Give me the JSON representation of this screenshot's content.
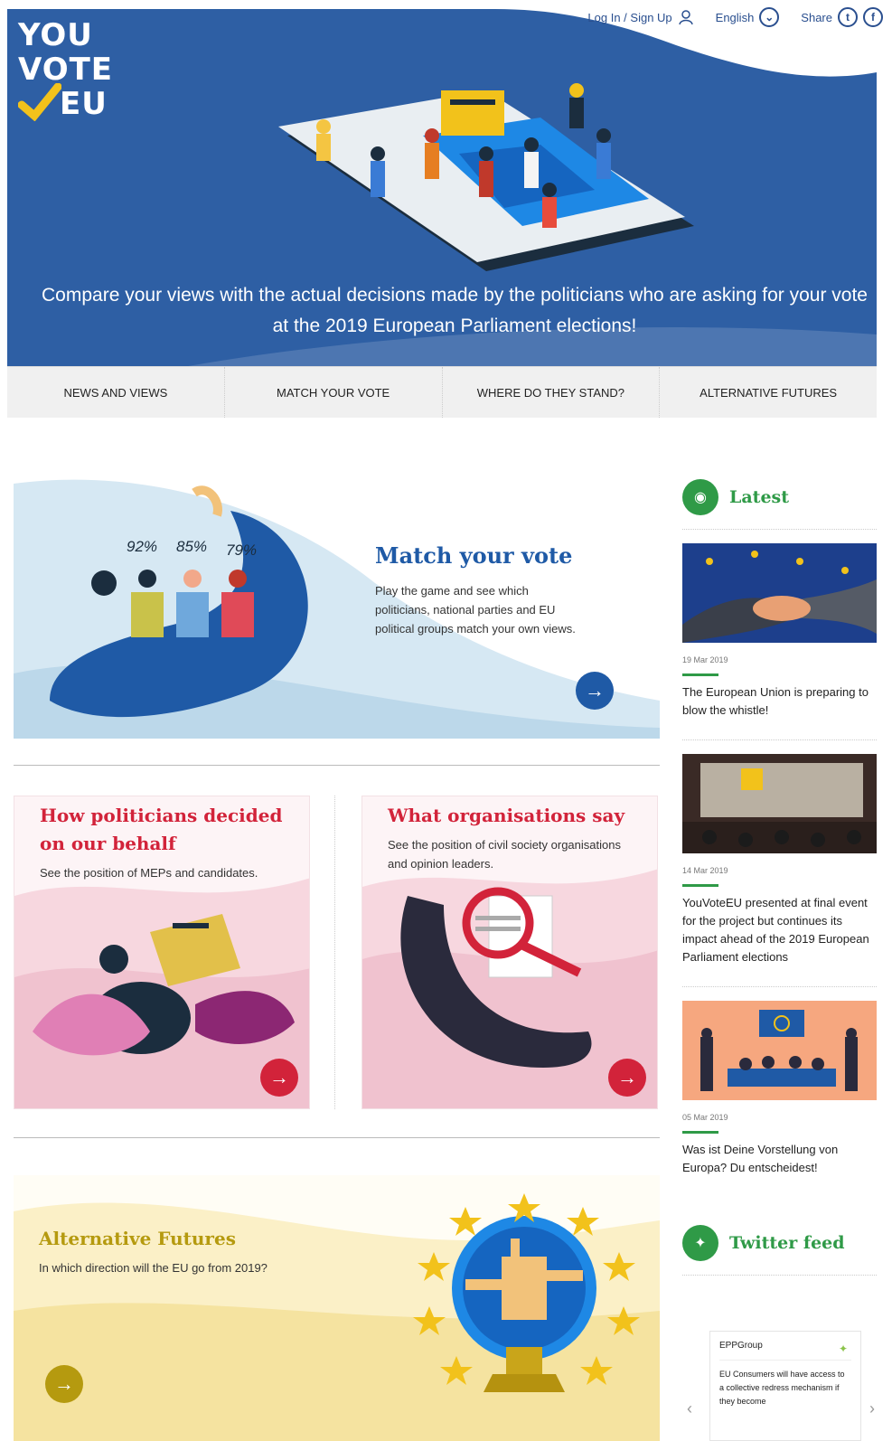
{
  "brand": {
    "line1": "YOU",
    "line2": "VOTE",
    "line3": "EU"
  },
  "topbar": {
    "login_label": "Log In / Sign Up",
    "language_label": "English",
    "share_label": "Share"
  },
  "hero": {
    "tagline": "Compare your views with the actual decisions made by the politicians who are asking for your vote at the 2019 European Parliament elections!"
  },
  "nav": {
    "items": [
      {
        "label": "NEWS AND VIEWS"
      },
      {
        "label": "MATCH YOUR VOTE"
      },
      {
        "label": "WHERE DO THEY STAND?"
      },
      {
        "label": "ALTERNATIVE FUTURES"
      }
    ]
  },
  "match": {
    "title": "Match your vote",
    "description": "Play the game and see which politicians, national parties and EU political groups match your own views.",
    "pct1": "92%",
    "pct2": "85%",
    "pct3": "79%"
  },
  "politicians": {
    "title": "How politicians decided on our behalf",
    "description": "See the position of MEPs and candidates."
  },
  "organisations": {
    "title": "What organisations say",
    "description": "See the position of civil society organisations and opinion leaders."
  },
  "alternative": {
    "title": "Alternative Futures",
    "description": "In which direction will the EU go from 2019?"
  },
  "sidebar": {
    "latest_heading": "Latest",
    "news": [
      {
        "date": "19 Mar 2019",
        "title": "The European Union is preparing to blow the whistle!"
      },
      {
        "date": "14 Mar 2019",
        "title": "YouVoteEU presented at final event for the project but continues its impact ahead of the 2019 European Parliament elections"
      },
      {
        "date": "05 Mar 2019",
        "title": "Was ist Deine Vorstellung von Europa? Du entscheidest!"
      }
    ],
    "twitter_heading": "Twitter feed",
    "tweet": {
      "user": "EPPGroup",
      "text": "EU Consumers will have access to a collective redress mechanism if they become"
    }
  },
  "colors": {
    "hero_blue": "#2e5fa4",
    "brand_yellow": "#f2c21b",
    "match_blue": "#1f5aa6",
    "card_red": "#d2233a",
    "alt_gold": "#b59a0f",
    "side_green": "#2f9a47"
  }
}
